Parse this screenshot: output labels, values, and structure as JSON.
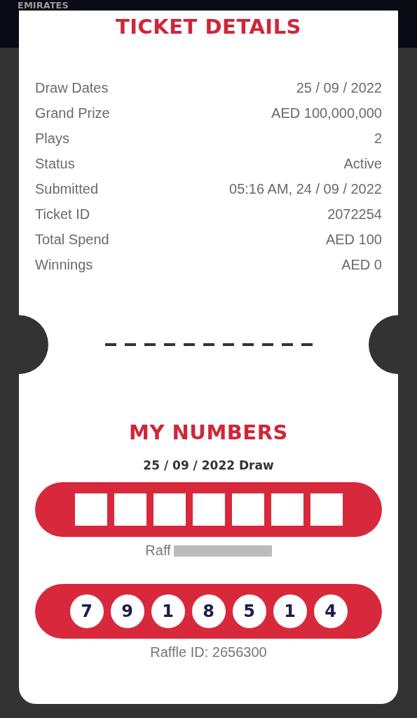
{
  "background": {
    "brand": "EMIRATES"
  },
  "ticket_details": {
    "title": "TICKET DETAILS",
    "rows": [
      {
        "label": "Draw Dates",
        "value": "25 / 09 / 2022"
      },
      {
        "label": "Grand Prize",
        "value": "AED 100,000,000"
      },
      {
        "label": "Plays",
        "value": "2"
      },
      {
        "label": "Status",
        "value": "Active"
      },
      {
        "label": "Submitted",
        "value": "05:16 AM, 24 / 09 / 2022"
      },
      {
        "label": "Ticket ID",
        "value": "2072254"
      },
      {
        "label": "Total Spend",
        "value": "AED 100"
      },
      {
        "label": "Winnings",
        "value": "AED 0"
      }
    ]
  },
  "my_numbers": {
    "title": "MY NUMBERS",
    "draw_label": "25 / 09 / 2022 Draw",
    "plays": [
      {
        "redacted": true,
        "raffle": "Raff"
      },
      {
        "redacted": false,
        "numbers": [
          "7",
          "9",
          "1",
          "8",
          "5",
          "1",
          "4"
        ],
        "raffle": "Raffle ID: 2656300"
      }
    ]
  }
}
